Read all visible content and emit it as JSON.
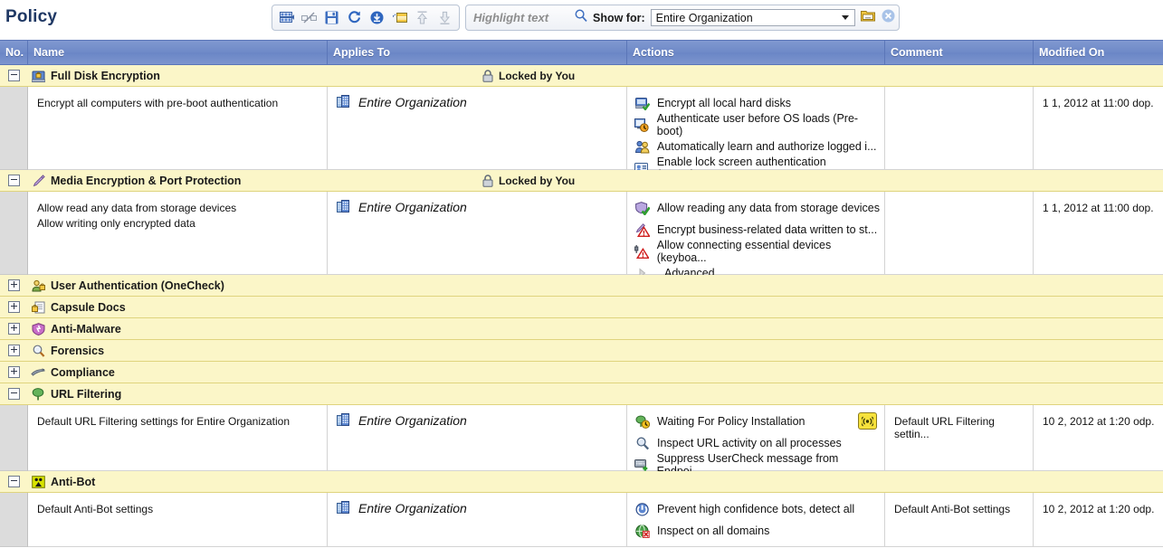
{
  "header": {
    "title": "Policy",
    "toolbar": [
      {
        "name": "columns-icon",
        "tip": "Columns"
      },
      {
        "name": "disconnect-icon",
        "tip": "Disconnect"
      },
      {
        "name": "save-icon",
        "tip": "Save"
      },
      {
        "name": "refresh-icon",
        "tip": "Refresh"
      },
      {
        "name": "install-icon",
        "tip": "Install Policy"
      },
      {
        "name": "add-rule-icon",
        "tip": "Add Rule"
      },
      {
        "name": "move-up-icon",
        "tip": "Move Up"
      },
      {
        "name": "move-down-icon",
        "tip": "Move Down"
      }
    ],
    "search": {
      "placeholder": "Highlight text",
      "value": "",
      "icon": "search-icon"
    },
    "show_for": {
      "label": "Show for:",
      "value": "Entire Organization",
      "options": [
        "Entire Organization"
      ],
      "browse_icon": "folder-browse-icon",
      "clear_icon": "clear-icon"
    }
  },
  "grid": {
    "columns": [
      {
        "key": "no",
        "label": "No."
      },
      {
        "key": "name",
        "label": "Name"
      },
      {
        "key": "applies",
        "label": "Applies To"
      },
      {
        "key": "actions",
        "label": "Actions"
      },
      {
        "key": "comment",
        "label": "Comment"
      },
      {
        "key": "modified",
        "label": "Modified On"
      }
    ],
    "locked_label": "Locked by You",
    "groups": [
      {
        "id": "full-disk-encryption",
        "title": "Full Disk Encryption",
        "icon": "disk-lock-icon",
        "expanded": true,
        "locked": true,
        "rows": [
          {
            "name_lines": [
              "Encrypt all computers with pre-boot authentication"
            ],
            "applies_to": "Entire Organization",
            "applies_icon": "organization-icon",
            "actions": [
              {
                "icon": "disk-check-icon",
                "text": "Encrypt all local hard disks"
              },
              {
                "icon": "preboot-icon",
                "text": "Authenticate user before OS loads (Pre-boot)"
              },
              {
                "icon": "users-icon",
                "text": "Automatically learn and authorize logged i..."
              },
              {
                "icon": "id-card-icon",
                "text": "Enable lock screen authentication (OneChe..."
              }
            ],
            "comment": "",
            "modified": "1 1, 2012 at 11:00 dop.",
            "height": 92
          }
        ]
      },
      {
        "id": "media-encryption-port-protection",
        "title": "Media Encryption & Port Protection",
        "icon": "pen-icon",
        "expanded": true,
        "locked": true,
        "rows": [
          {
            "name_lines": [
              "Allow read any data from storage devices",
              "Allow writing only encrypted data"
            ],
            "applies_to": "Entire Organization",
            "applies_icon": "organization-icon",
            "actions": [
              {
                "icon": "shield-check-icon",
                "text": "Allow reading any data from storage devices"
              },
              {
                "icon": "encrypt-warn-icon",
                "text": "Encrypt business-related data written to st..."
              },
              {
                "icon": "device-warn-icon",
                "text": "Allow connecting essential devices (keyboa..."
              },
              {
                "icon": "expand-arrow-icon",
                "text": "Advanced"
              }
            ],
            "comment": "",
            "modified": "1 1, 2012 at 11:00 dop.",
            "height": 92
          }
        ]
      },
      {
        "id": "user-authentication-onecheck",
        "title": "User Authentication (OneCheck)",
        "icon": "user-lock-icon",
        "expanded": false,
        "locked": false,
        "rows": []
      },
      {
        "id": "capsule-docs",
        "title": "Capsule Docs",
        "icon": "document-lock-icon",
        "expanded": false,
        "locked": false,
        "rows": []
      },
      {
        "id": "anti-malware",
        "title": "Anti-Malware",
        "icon": "malware-shield-icon",
        "expanded": false,
        "locked": false,
        "rows": []
      },
      {
        "id": "forensics",
        "title": "Forensics",
        "icon": "magnifier-icon",
        "expanded": false,
        "locked": false,
        "rows": []
      },
      {
        "id": "compliance",
        "title": "Compliance",
        "icon": "compliance-icon",
        "expanded": false,
        "locked": false,
        "rows": []
      },
      {
        "id": "url-filtering",
        "title": "URL Filtering",
        "icon": "tree-icon",
        "expanded": true,
        "locked": false,
        "rows": [
          {
            "name_lines": [
              "Default URL Filtering settings for Entire Organization"
            ],
            "applies_to": "Entire Organization",
            "applies_icon": "organization-icon",
            "actions": [
              {
                "icon": "waiting-icon",
                "text": "Waiting For Policy Installation",
                "badge": "broadcast-badge-icon"
              },
              {
                "icon": "inspect-icon",
                "text": "Inspect URL activity on all processes"
              },
              {
                "icon": "suppress-icon",
                "text": "Suppress UserCheck message from Endpoi..."
              }
            ],
            "comment": "Default URL Filtering settin...",
            "modified": "10 2, 2012 at 1:20 odp.",
            "height": 73
          }
        ]
      },
      {
        "id": "anti-bot",
        "title": "Anti-Bot",
        "icon": "bot-icon",
        "expanded": true,
        "locked": false,
        "rows": [
          {
            "name_lines": [
              "Default Anti-Bot settings"
            ],
            "applies_to": "Entire Organization",
            "applies_icon": "organization-icon",
            "actions": [
              {
                "icon": "prevent-icon",
                "text": "Prevent high confidence bots, detect all"
              },
              {
                "icon": "domains-icon",
                "text": "Inspect on all domains"
              }
            ],
            "comment": "Default Anti-Bot settings",
            "modified": "10 2, 2012 at 1:20 odp.",
            "height": 60
          }
        ]
      }
    ]
  },
  "colors": {
    "header_blue": "#6f8ac8",
    "group_yellow": "#fbf6c8",
    "title_navy": "#1f3864",
    "badge_yellow": "#f7e23c"
  }
}
